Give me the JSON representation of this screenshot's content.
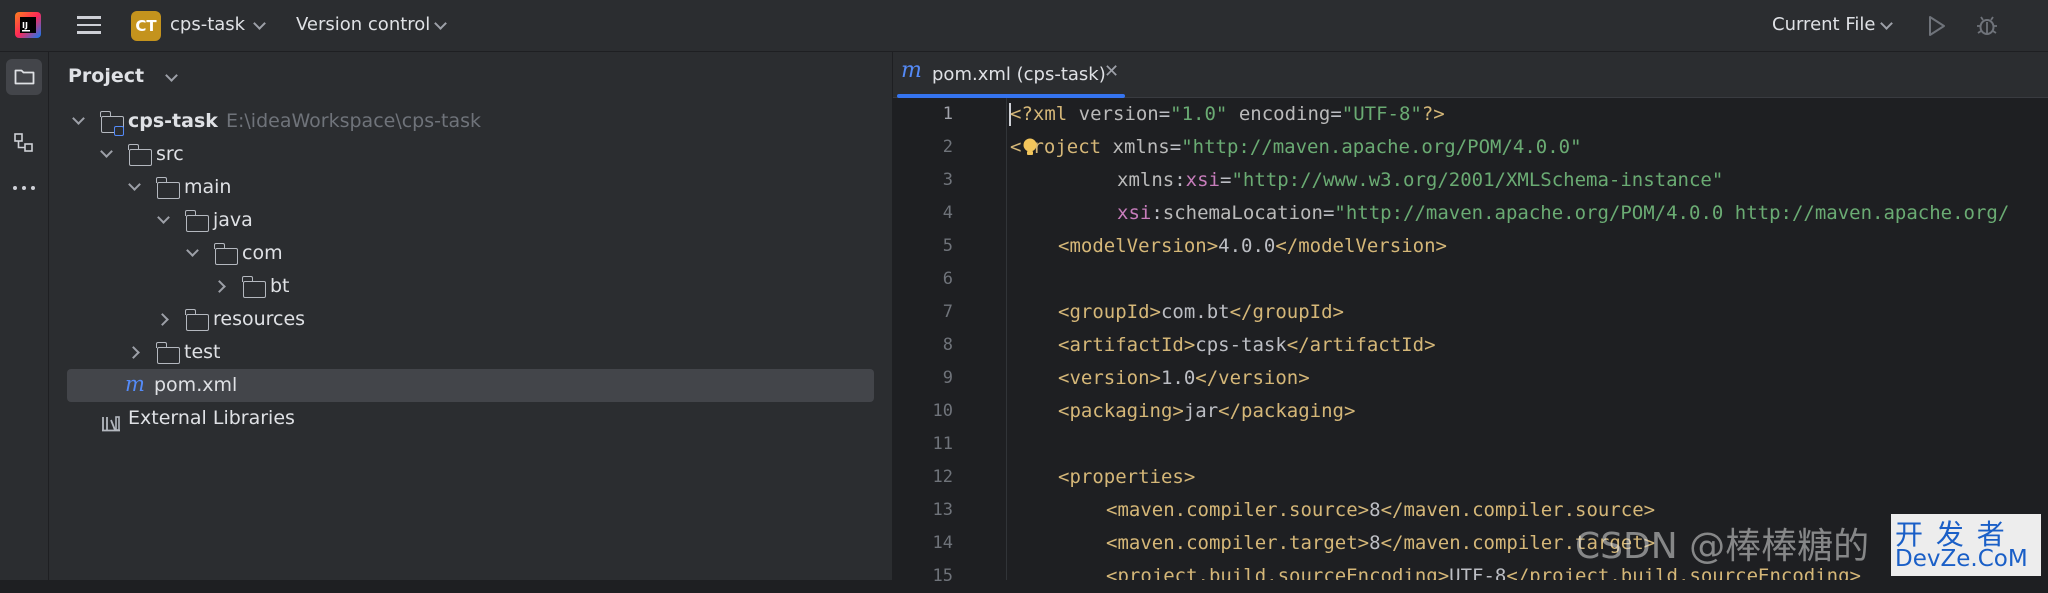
{
  "titlebar": {
    "project_badge": "CT",
    "project_name": "cps-task",
    "vcs_label": "Version control",
    "run_config": "Current File"
  },
  "project_panel": {
    "title": "Project",
    "tree": [
      {
        "label": "cps-task",
        "hint": "E:\\ideaWorkspace\\cps-task",
        "kind": "module",
        "expanded": true
      },
      {
        "label": "src",
        "kind": "folder",
        "expanded": true
      },
      {
        "label": "main",
        "kind": "folder",
        "expanded": true
      },
      {
        "label": "java",
        "kind": "folder",
        "expanded": true
      },
      {
        "label": "com",
        "kind": "folder",
        "expanded": true
      },
      {
        "label": "bt",
        "kind": "folder",
        "expanded": false
      },
      {
        "label": "resources",
        "kind": "folder",
        "expanded": false
      },
      {
        "label": "test",
        "kind": "folder",
        "expanded": false
      },
      {
        "label": "pom.xml",
        "kind": "maven-file",
        "selected": true
      },
      {
        "label": "External Libraries",
        "kind": "libraries"
      }
    ]
  },
  "editor": {
    "tab_title": "pom.xml (cps-task)",
    "lines": [
      {
        "n": "1"
      },
      {
        "n": "2"
      },
      {
        "n": "3"
      },
      {
        "n": "4"
      },
      {
        "n": "5"
      },
      {
        "n": "6"
      },
      {
        "n": "7"
      },
      {
        "n": "8"
      },
      {
        "n": "9"
      },
      {
        "n": "10"
      },
      {
        "n": "11"
      },
      {
        "n": "12"
      },
      {
        "n": "13"
      },
      {
        "n": "14"
      },
      {
        "n": "15"
      }
    ],
    "code": {
      "l1": {
        "a": "<?xml ",
        "b": "version",
        "c": "=",
        "d": "\"1.0\"",
        "e": " encoding",
        "f": "=",
        "g": "\"UTF-8\"",
        "h": "?>"
      },
      "l2": {
        "a": "<",
        "b": "roject",
        "c": " xmlns",
        "d": "=",
        "e": "\"http://maven.apache.org/POM/4.0.0\""
      },
      "l3": {
        "a": "xmlns",
        "b": ":",
        "c": "xsi",
        "d": "=",
        "e": "\"http://www.w3.org/2001/XMLSchema-instance\""
      },
      "l4": {
        "a": "xsi",
        "b": ":",
        "c": "schemaLocation",
        "d": "=",
        "e": "\"http://maven.apache.org/POM/4.0.0 http://maven.apache.org/"
      },
      "l5": {
        "a": "<modelVersion>",
        "b": "4.0.0",
        "c": "</modelVersion>"
      },
      "l7": {
        "a": "<groupId>",
        "b": "com.bt",
        "c": "</groupId>"
      },
      "l8": {
        "a": "<artifactId>",
        "b": "cps-task",
        "c": "</artifactId>"
      },
      "l9": {
        "a": "<version>",
        "b": "1.0",
        "c": "</version>"
      },
      "l10": {
        "a": "<packaging>",
        "b": "jar",
        "c": "</packaging>"
      },
      "l12": {
        "a": "<properties>"
      },
      "l13": {
        "a": "<maven.compiler.source>",
        "b": "8",
        "c": "</maven.compiler.source>"
      },
      "l14": {
        "a": "<maven.compiler.target>",
        "b": "8",
        "c": "</maven.compiler.target>"
      },
      "l15": {
        "a": "<project.build.sourceEncoding>",
        "b": "UTF-8",
        "c": "</project.build.sourceEncoding>"
      }
    }
  },
  "watermark": {
    "text": "CSDN @棒棒糖的",
    "logo_line1": "开 发 者",
    "logo_line2": "DevZe.CoM"
  },
  "colors": {
    "accent": "#3574f0",
    "badge": "#c4931d",
    "maven": "#548af7"
  }
}
